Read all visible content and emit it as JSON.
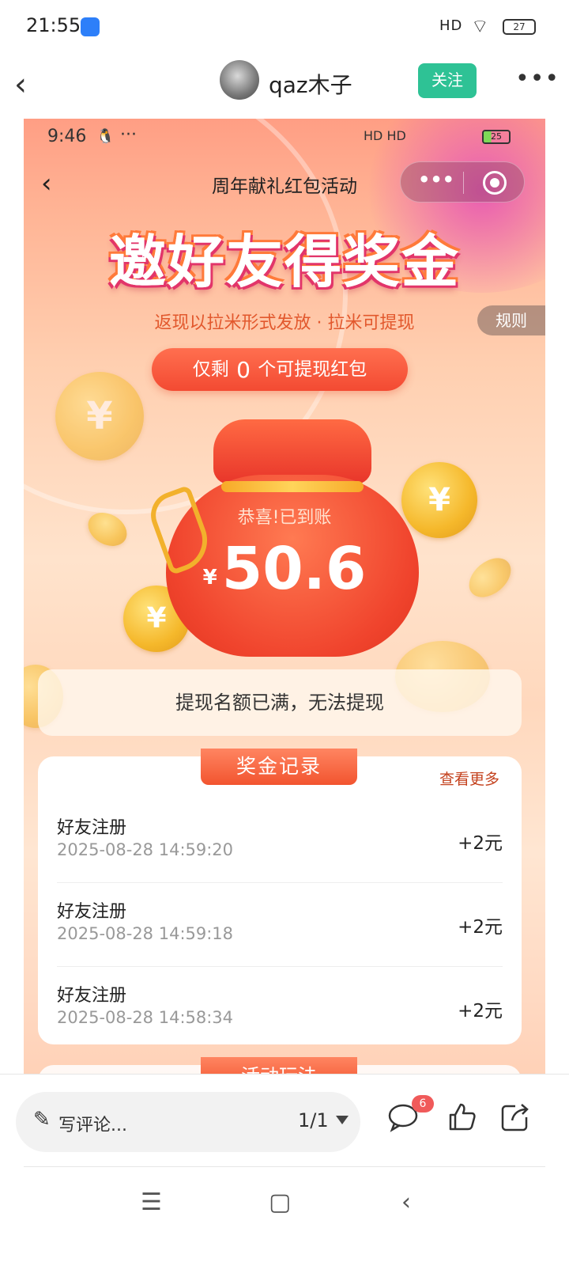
{
  "status_bar": {
    "time": "21:55",
    "signal": "HD",
    "battery": "27"
  },
  "post_header": {
    "username": "qaz木子",
    "follow_label": "关注"
  },
  "embedded": {
    "status_time": "9:46",
    "status_dots": "···",
    "status_signal": "HD HD",
    "battery": "25",
    "page_title": "周年献礼红包活动",
    "headline": "邀好友得奖金",
    "subtitle": "返现以拉米形式发放 · 拉米可提现",
    "rules_label": "规则",
    "remaining_prefix": "仅剩",
    "remaining_count": "0",
    "remaining_suffix": "个可提现红包",
    "coin_symbol": "¥",
    "congrats": "恭喜!已到账",
    "currency": "¥",
    "amount": "50.6",
    "quota_notice": "提现名额已满，无法提现",
    "records_title": "奖金记录",
    "see_more": "查看更多",
    "records": [
      {
        "name": "好友注册",
        "time": "2025-08-28 14:59:20",
        "amount": "+2元"
      },
      {
        "name": "好友注册",
        "time": "2025-08-28 14:59:18",
        "amount": "+2元"
      },
      {
        "name": "好友注册",
        "time": "2025-08-28 14:58:34",
        "amount": "+2元"
      }
    ],
    "next_section_title": "活动玩法"
  },
  "bottom_bar": {
    "comment_placeholder": "写评论...",
    "page_indicator": "1/1",
    "comment_count": "6"
  },
  "colors": {
    "follow": "#2ec295",
    "accent": "#f34a32",
    "badge": "#f05a5a"
  }
}
